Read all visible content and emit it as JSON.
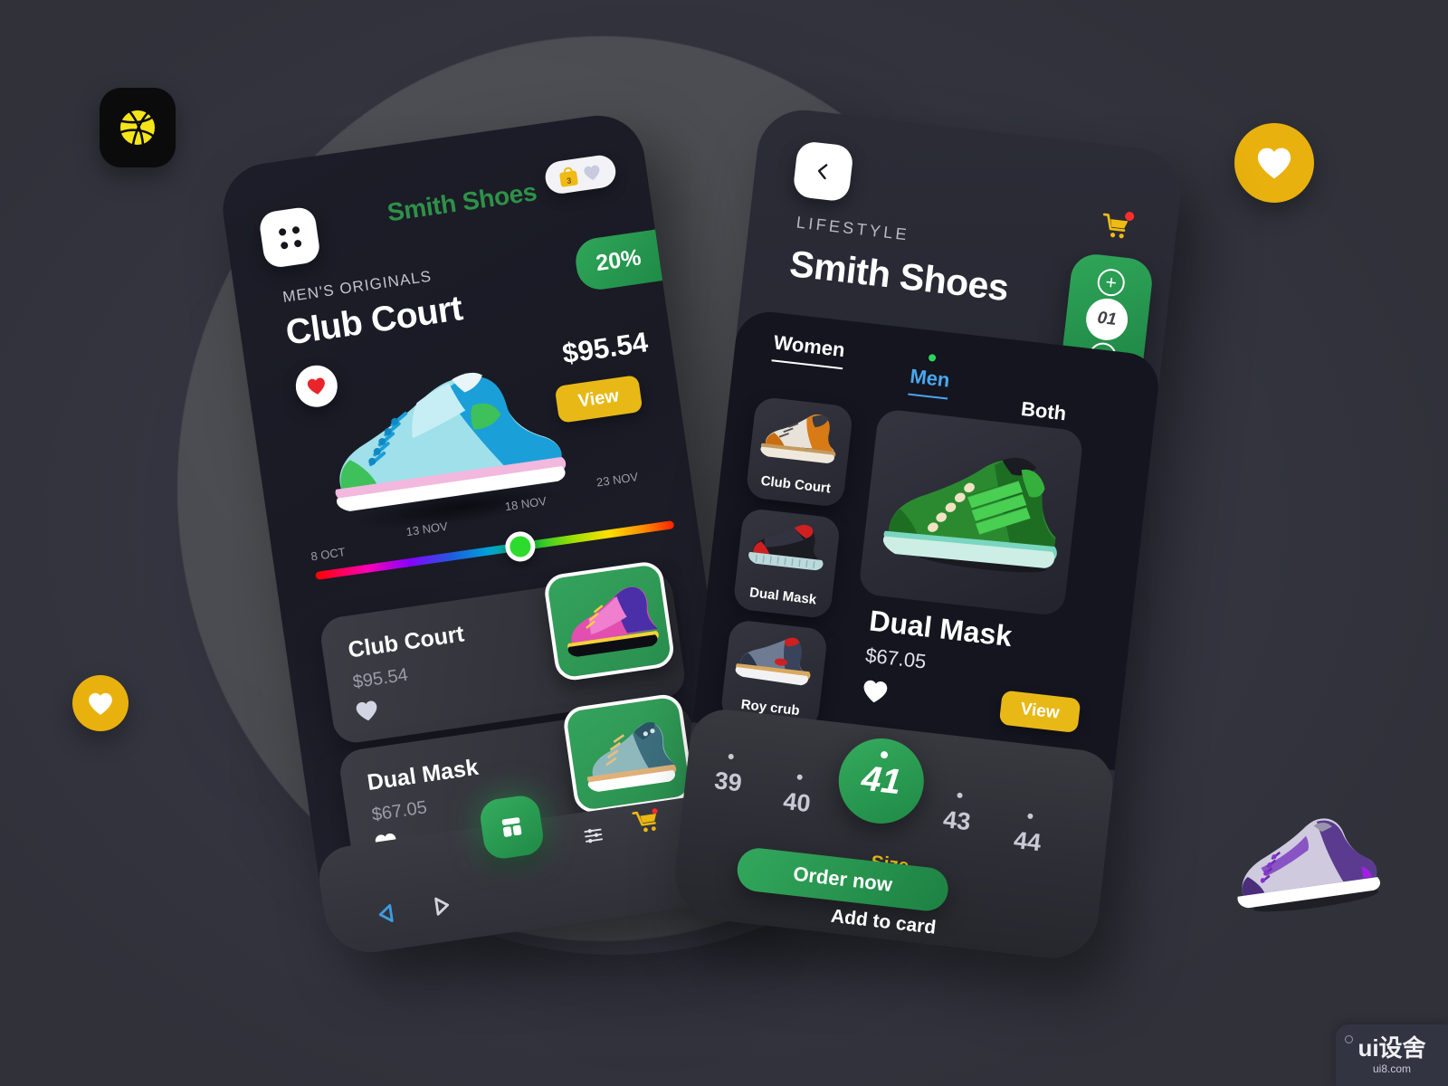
{
  "background": {
    "page_bg": "#343540",
    "circle_color": "#4b4c51",
    "accent_green": "#2e9148",
    "accent_yellow": "#e8b817",
    "accent_blue": "#4aa7ef"
  },
  "decor": {
    "logo_icon": "dribbble-basketball-icon",
    "heart_badge_top": "heart-icon",
    "heart_badge_bottom": "heart-icon",
    "floating_shoe": "purple-sneaker-illustration"
  },
  "watermark": {
    "main": "ui设舍",
    "sub": "ui8.com"
  },
  "phone1": {
    "menu_icon": "grid-dots-icon",
    "title": "Smith Shoes",
    "badge": {
      "bag_count": "3",
      "bag_icon": "shopping-bag-icon",
      "heart_icon": "heart-icon"
    },
    "category": "MEN'S ORIGINALS",
    "product_name": "Club Court",
    "discount": "20%",
    "price": "$95.54",
    "view_label": "View",
    "favorite_icon": "heart-filled-icon",
    "hero_image": "blue-green-sneaker-illustration",
    "dates": [
      "8 OCT",
      "13 NOV",
      "18 NOV",
      "23 NOV"
    ],
    "slider_value": 62,
    "list": [
      {
        "name": "Club Court",
        "price": "$95.54",
        "heart_icon": "heart-icon",
        "thumb": "purple-pink-sneaker-illustration"
      },
      {
        "name": "Dual Mask",
        "price": "$67.05",
        "heart_icon": "heart-icon",
        "thumb": "teal-high-top-sneaker-illustration"
      }
    ],
    "nav": {
      "fab_icon": "dashboard-grid-icon",
      "filter_icon": "sliders-icon",
      "cart_icon": "shopping-cart-icon",
      "sys_back_icon": "triangle-back-icon",
      "sys_home_icon": "triangle-home-icon"
    }
  },
  "phone2": {
    "back_icon": "chevron-left-icon",
    "cart_icon": "shopping-cart-icon",
    "kicker": "LIFESTYLE",
    "title": "Smith Shoes",
    "quantity": {
      "plus_label": "+",
      "value": "01",
      "minus_label": "−"
    },
    "tabs": [
      {
        "label": "Women",
        "active": false
      },
      {
        "label": "Men",
        "active": true
      },
      {
        "label": "Both",
        "active": false
      }
    ],
    "thumbnails": [
      {
        "label": "Club Court",
        "image": "orange-brown-high-top-illustration"
      },
      {
        "label": "Dual Mask",
        "image": "black-red-sneaker-illustration"
      },
      {
        "label": "Roy crub",
        "image": "grey-navy-runner-illustration"
      }
    ],
    "hero_image": "green-striped-sneaker-illustration",
    "product_name": "Dual Mask",
    "product_price": "$67.05",
    "favorite_icon": "heart-icon",
    "view_label": "View",
    "sizes": [
      "39",
      "40",
      "41",
      "43",
      "44"
    ],
    "selected_size": "41",
    "size_label": "Size",
    "order_label": "Order now",
    "addcard_label": "Add to card"
  }
}
